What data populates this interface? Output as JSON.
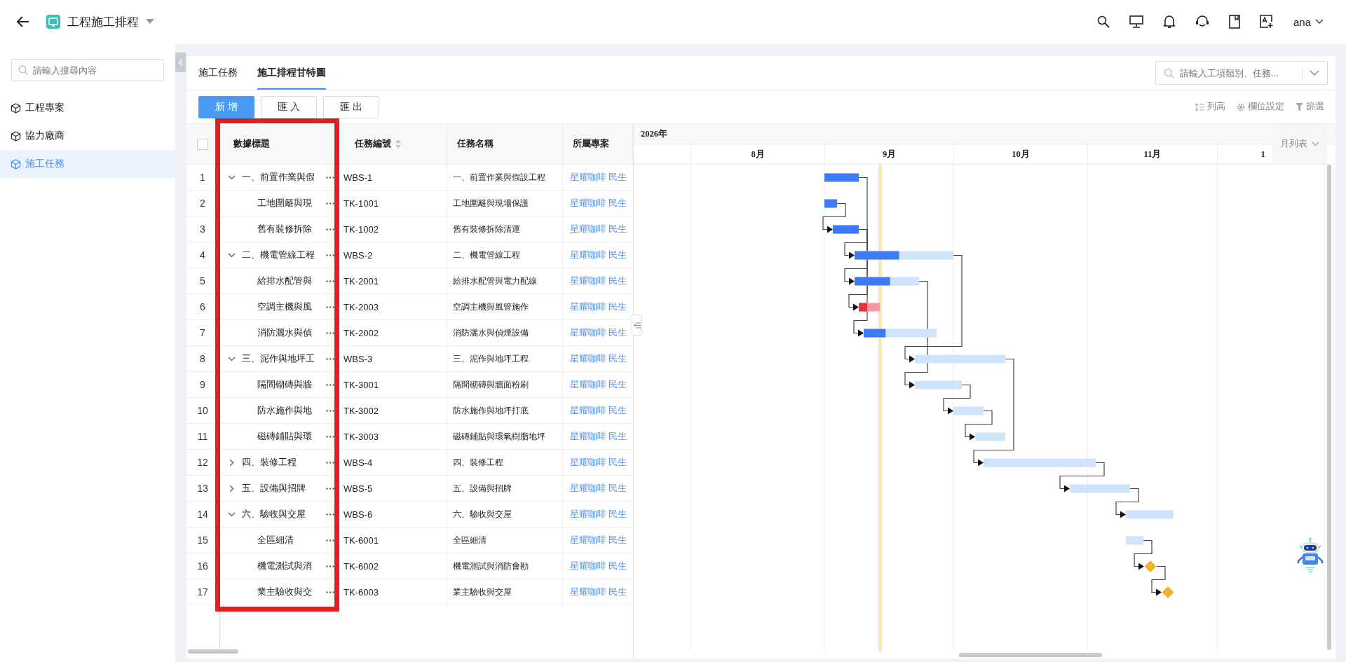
{
  "header": {
    "title": "工程施工排程",
    "user": "ana"
  },
  "sidebar": {
    "search": {
      "placeholder": "請輸入搜尋內容"
    },
    "items": [
      {
        "label": "工程專案",
        "selected": false
      },
      {
        "label": "協力廠商",
        "selected": false
      },
      {
        "label": "施工任務",
        "selected": true
      }
    ]
  },
  "tabs": [
    {
      "label": "施工任務",
      "selected": false
    },
    {
      "label": "施工排程甘特圖",
      "selected": true
    }
  ],
  "search": {
    "placeholder": "請輸入工項類別、任務..."
  },
  "toolbar": {
    "buttons": [
      {
        "label": "新 增",
        "kind": "primary"
      },
      {
        "label": "匯 入",
        "kind": "default"
      },
      {
        "label": "匯 出",
        "kind": "default"
      }
    ],
    "tools": [
      {
        "label": "列高",
        "kind": "row-height"
      },
      {
        "label": "欄位設定",
        "kind": "settings"
      },
      {
        "label": "篩選",
        "kind": "filter"
      }
    ]
  },
  "table": {
    "select_all": {
      "checked": false
    },
    "columns": [
      {
        "label": "數據標題",
        "kind": "framed"
      },
      {
        "label": "任務編號",
        "kind": "sortable"
      },
      {
        "label": "任務名稱",
        "kind": "plain"
      },
      {
        "label": "所屬專案",
        "kind": "plain"
      }
    ],
    "tasks": [
      {
        "number": "1",
        "title": "一、前置作業與假",
        "code": "WBS-1",
        "name": "一、前置作業與假設工程",
        "project": "星耀咖啡 民生",
        "expanded": true,
        "gantt": {
          "kind": "bar",
          "level": 1,
          "overdue": false
        },
        "children": [
          {
            "number": "2",
            "title": "工地圍籬與現",
            "code": "TK-1001",
            "name": "工地圍籬與現場保護",
            "project": "星耀咖啡 民生",
            "gantt": {
              "kind": "bar",
              "level": 1,
              "overdue": false
            }
          },
          {
            "number": "3",
            "title": "舊有裝修拆除",
            "code": "TK-1002",
            "name": "舊有裝修拆除清運",
            "project": "星耀咖啡 民生",
            "gantt": {
              "kind": "bar",
              "level": 1,
              "overdue": false
            }
          }
        ]
      },
      {
        "number": "4",
        "title": "二、機電管線工程",
        "code": "WBS-2",
        "name": "二、機電管線工程",
        "project": "星耀咖啡 民生",
        "expanded": true,
        "gantt": {
          "kind": "bar",
          "level": 0.45,
          "overdue": false
        },
        "children": [
          {
            "number": "5",
            "title": "給排水配管與",
            "code": "TK-2001",
            "name": "給排水配管與電力配線",
            "project": "星耀咖啡 民生",
            "gantt": {
              "kind": "bar",
              "level": 0.55,
              "overdue": false
            }
          },
          {
            "number": "6",
            "title": "空調主機與風",
            "code": "TK-2003",
            "name": "空調主機與風管施作",
            "project": "星耀咖啡 民生",
            "gantt": {
              "kind": "bar",
              "level": 0.4,
              "overdue": true
            }
          },
          {
            "number": "7",
            "title": "消防灑水與偵",
            "code": "TK-2002",
            "name": "消防灑水與偵煙設備",
            "project": "星耀咖啡 民生",
            "gantt": {
              "kind": "bar",
              "level": 0.3,
              "overdue": false
            }
          }
        ]
      },
      {
        "number": "8",
        "title": "三、泥作與地坪工",
        "code": "WBS-3",
        "name": "三、泥作與地坪工程",
        "project": "星耀咖啡 民生",
        "expanded": true,
        "gantt": {
          "kind": "bar",
          "overdue": false
        },
        "children": [
          {
            "number": "9",
            "title": "隔間砌磚與牆",
            "code": "TK-3001",
            "name": "隔間砌磚與牆面粉刷",
            "project": "星耀咖啡 民生",
            "gantt": {
              "kind": "bar",
              "overdue": false
            }
          },
          {
            "number": "10",
            "title": "防水施作與地",
            "code": "TK-3002",
            "name": "防水施作與地坪打底",
            "project": "星耀咖啡 民生",
            "gantt": {
              "kind": "bar",
              "overdue": false
            }
          },
          {
            "number": "11",
            "title": "磁磚鋪貼與環",
            "code": "TK-3003",
            "name": "磁磚鋪貼與環氧樹脂地坪",
            "project": "星耀咖啡 民生",
            "gantt": {
              "kind": "bar",
              "overdue": false
            }
          }
        ]
      },
      {
        "number": "12",
        "title": "四、裝修工程",
        "code": "WBS-4",
        "name": "四、裝修工程",
        "project": "星耀咖啡 民生",
        "expanded": false,
        "gantt": {
          "kind": "bar",
          "overdue": false
        }
      },
      {
        "number": "13",
        "title": "五、設備與招牌",
        "code": "WBS-5",
        "name": "五、設備與招牌",
        "project": "星耀咖啡 民生",
        "expanded": false,
        "gantt": {
          "kind": "bar",
          "overdue": false
        }
      },
      {
        "number": "14",
        "title": "六、驗收與交屋",
        "code": "WBS-6",
        "name": "六、驗收與交屋",
        "project": "星耀咖啡 民生",
        "expanded": true,
        "gantt": {
          "kind": "bar",
          "overdue": false
        },
        "children": [
          {
            "number": "15",
            "title": "全區細清",
            "code": "TK-6001",
            "name": "全區細清",
            "project": "星耀咖啡 民生",
            "gantt": {
              "kind": "bar",
              "overdue": false
            }
          },
          {
            "number": "16",
            "title": "機電測試與消",
            "code": "TK-6002",
            "name": "機電測試與消防會勘",
            "project": "星耀咖啡 民生",
            "gantt": {
              "kind": "milestone"
            }
          },
          {
            "number": "17",
            "title": "業主驗收與交",
            "code": "TK-6003",
            "name": "業主驗收與交屋",
            "project": "星耀咖啡 民生",
            "gantt": {
              "kind": "milestone"
            }
          }
        ]
      }
    ]
  },
  "gantt": {
    "year": "2026年",
    "months": [
      "8月",
      "9月",
      "10月",
      "11月",
      "1"
    ],
    "view": "月列表"
  }
}
